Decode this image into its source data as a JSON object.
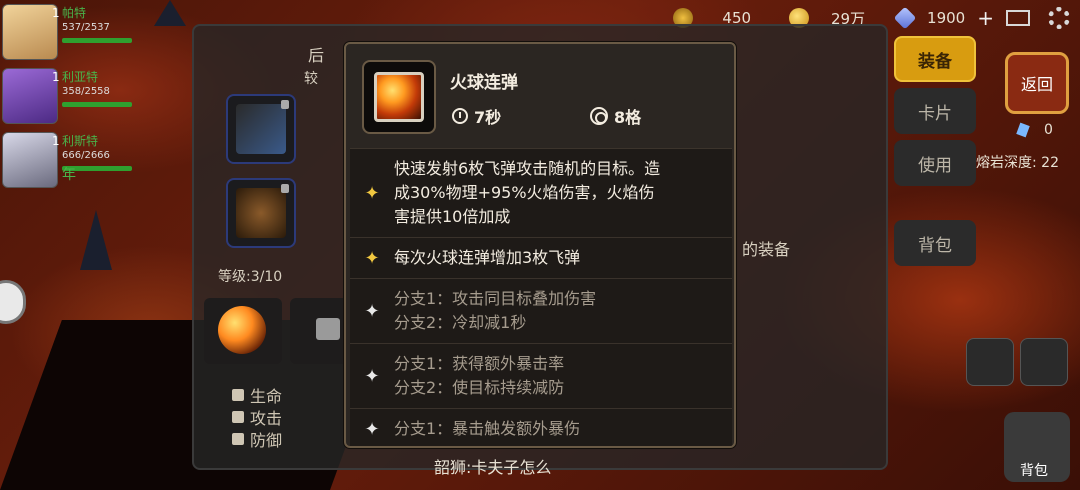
{
  "top_bar": {
    "leaf_value": "450",
    "gold_value": "29万",
    "gem_value": "1900",
    "add_symbol": "+"
  },
  "party": [
    {
      "level": "1",
      "name": "帕特",
      "hp": "537/2537"
    },
    {
      "level": "1",
      "name": "利亚特",
      "hp": "358/2558"
    },
    {
      "level": "1",
      "name": "利斯特",
      "hp": "666/2666"
    }
  ],
  "party_extra_text": "年",
  "equipment_panel": {
    "edit_label": "后",
    "compare_label": "较",
    "level_label": "等级:3/10",
    "stats": [
      "生命",
      "攻击",
      "防御"
    ],
    "hint_text": "的装备",
    "footer_text": "韶狮:卡夫子怎么"
  },
  "right_menu": {
    "equip_button": "装备",
    "card_button": "卡片",
    "use_button": "使用",
    "bag_button": "背包",
    "back_button": "返回",
    "crystal_count": "0",
    "depth_label": "熔岩深度: 22",
    "bag_bottom_label": "背包"
  },
  "tooltip": {
    "title": "火球连弹",
    "cooldown": "7秒",
    "range": "8格",
    "entries": [
      {
        "highlight": true,
        "lines": [
          "快速发射6枚飞弹攻击随机的目标。造",
          "成30%物理+95%火焰伤害，火焰伤",
          "害提供10倍加成"
        ]
      },
      {
        "highlight": true,
        "lines": [
          "每次火球连弹增加3枚飞弹"
        ]
      },
      {
        "highlight": false,
        "lines": [
          "分支1：攻击同目标叠加伤害",
          "分支2：冷却减1秒"
        ]
      },
      {
        "highlight": false,
        "lines": [
          "分支1：获得额外暴击率",
          "分支2：使目标持续减防"
        ]
      },
      {
        "highlight": false,
        "lines": [
          "分支1：暴击触发额外暴伤"
        ]
      }
    ],
    "star_symbol": "✦"
  },
  "colors": {
    "gold_button": "#d89c10",
    "tooltip_bg": "#2b2622",
    "tooltip_border": "#6a5a45",
    "star_gold": "#f2c840"
  }
}
